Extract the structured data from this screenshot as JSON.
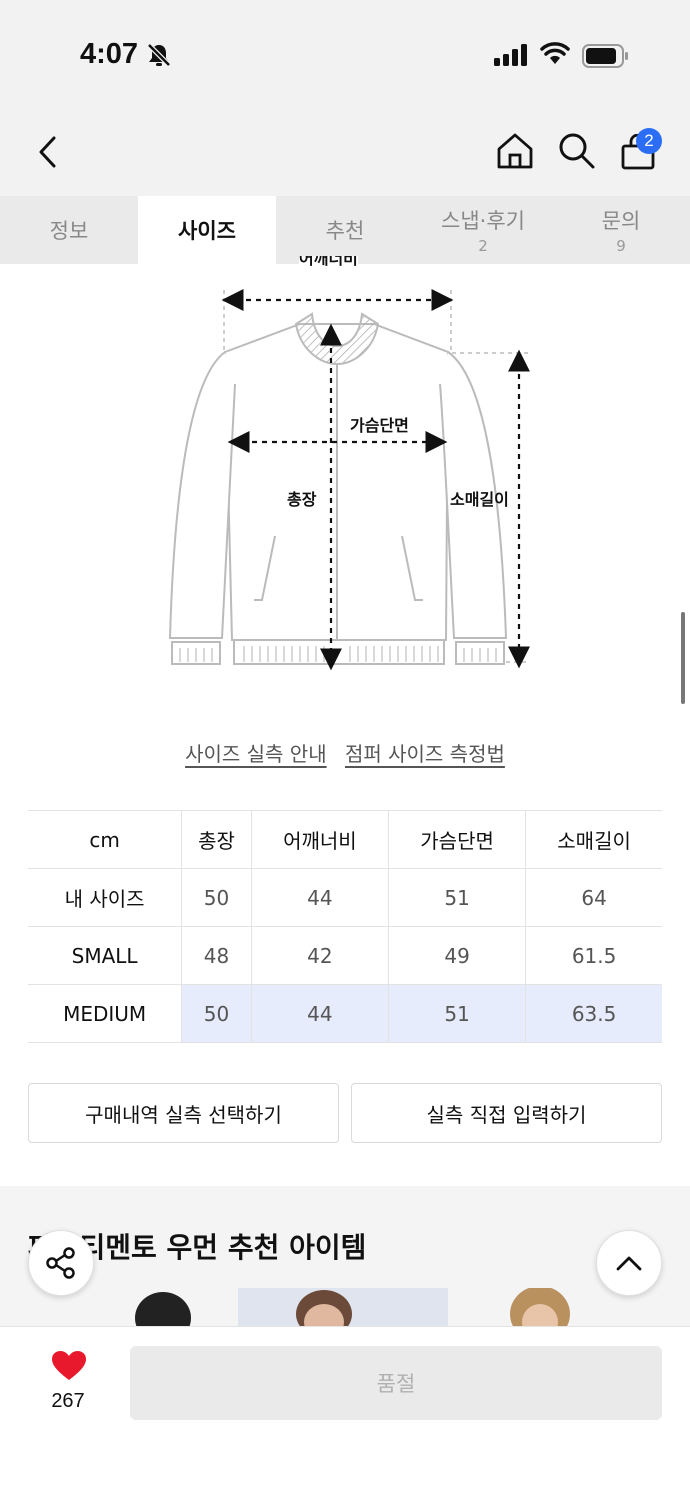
{
  "status": {
    "time": "4:07"
  },
  "nav": {
    "cart_count": "2"
  },
  "tabs": [
    {
      "label": "정보",
      "count": ""
    },
    {
      "label": "사이즈",
      "count": ""
    },
    {
      "label": "추천",
      "count": ""
    },
    {
      "label": "스냅·후기",
      "count": "2"
    },
    {
      "label": "문의",
      "count": "9"
    }
  ],
  "diagram": {
    "label_shoulder": "어깨너비",
    "label_chest": "가슴단면",
    "label_length": "총장",
    "label_sleeve": "소매길이"
  },
  "guide": {
    "link1": "사이즈 실측 안내",
    "link2": "점퍼 사이즈 측정법"
  },
  "size_table": {
    "headers": [
      "cm",
      "총장",
      "어깨너비",
      "가슴단면",
      "소매길이"
    ],
    "rows": [
      {
        "label": "내 사이즈",
        "values": [
          "50",
          "44",
          "51",
          "64"
        ]
      },
      {
        "label": "SMALL",
        "values": [
          "48",
          "42",
          "49",
          "61.5"
        ]
      },
      {
        "label": "MEDIUM",
        "values": [
          "50",
          "44",
          "51",
          "63.5"
        ]
      }
    ]
  },
  "buttons": {
    "purchase_history": "구매내역 실측 선택하기",
    "manual_input": "실측 직접 입력하기"
  },
  "recommend": {
    "title": "파르티멘토 우먼 추천 아이템"
  },
  "bottom": {
    "likes": "267",
    "soldout_label": "품절"
  },
  "colors": {
    "badge": "#2b6ef5",
    "heart": "#e8192c",
    "highlight_row": "#e6ecfb"
  }
}
